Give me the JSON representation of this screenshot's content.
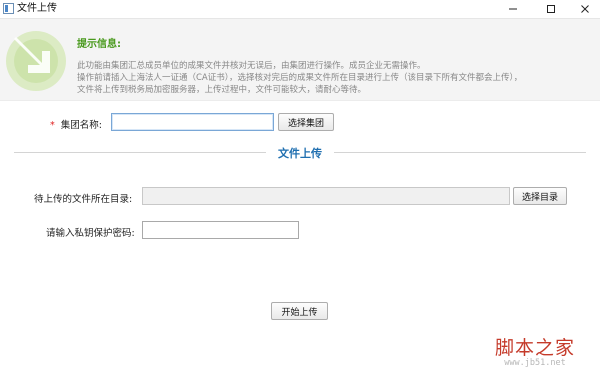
{
  "window": {
    "title": "文件上传"
  },
  "banner": {
    "tip_title": "提示信息:",
    "lines": [
      "此功能由集团汇总成员单位的成果文件并核对无误后，由集团进行操作。成员企业无需操作。",
      "操作前请插入上海法人一证通（CA证书），选择核对完后的成果文件所在目录进行上传（该目录下所有文件都会上传），",
      "文件将上传到税务局加密服务器，上传过程中，文件可能较大，请耐心等待。"
    ]
  },
  "group": {
    "required_mark": "*",
    "label": "集团名称:",
    "value": "",
    "select_button": "选择集团"
  },
  "section": {
    "title": "文件上传"
  },
  "directory": {
    "label": "待上传的文件所在目录:",
    "value": "",
    "select_button": "选择目录"
  },
  "password": {
    "label": "请输入私钥保护密码:",
    "value": ""
  },
  "actions": {
    "upload_button": "开始上传"
  },
  "watermark": {
    "main": "脚本之家",
    "url": "www.jb51.net"
  },
  "colors": {
    "tip_green": "#4a9a1e",
    "section_blue": "#1f6fb0",
    "required_red": "#e02020"
  }
}
